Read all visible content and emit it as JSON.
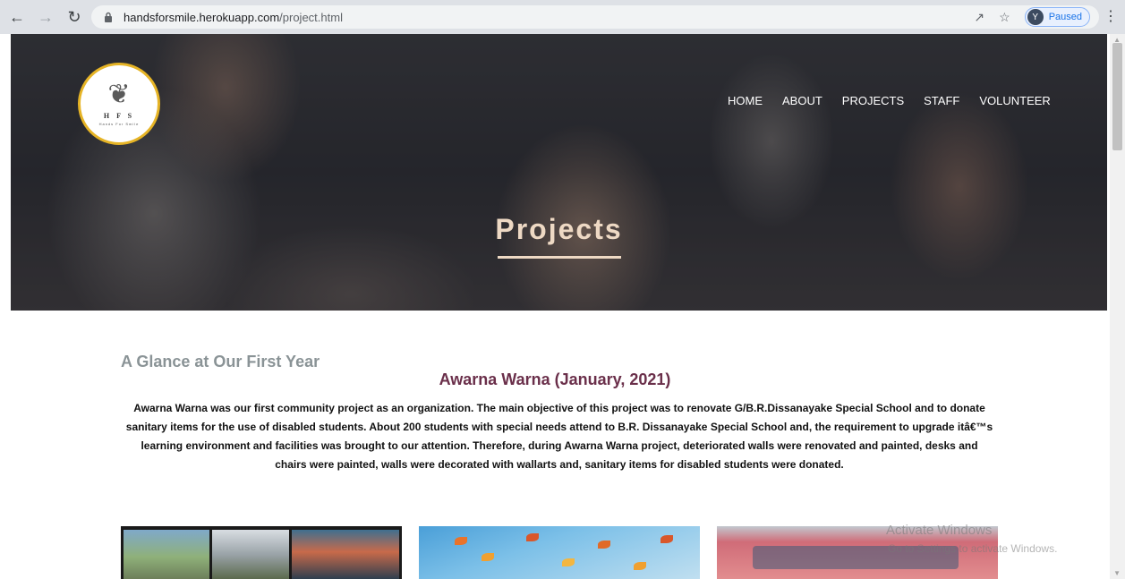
{
  "browser": {
    "url_host": "handsforsmile.herokuapp.com",
    "url_path": "/project.html",
    "profile_initial": "Y",
    "profile_label": "Paused"
  },
  "site": {
    "logo_initials": "H F S",
    "logo_tagline": "Hands For Smile",
    "nav": [
      "HOME",
      "ABOUT",
      "PROJECTS",
      "STAFF",
      "VOLUNTEER"
    ],
    "hero_title": "Projects"
  },
  "content": {
    "section_heading": "A Glance at Our First Year",
    "project_title": "Awarna Warna (January, 2021)",
    "project_description": "Awarna Warna was our first community project as an organization. The main objective of this project was to renovate G/B.R.Dissanayake Special School and to donate sanitary items for the use of disabled students. About 200 students with special needs attend to B.R. Dissanayake Special School and, the requirement to upgrade itâ€™s learning environment and facilities was brought to our attention. Therefore, during Awarna Warna project, deteriorated walls were renovated and painted, desks and chairs were painted, walls were decorated with wallarts and, sanitary items for disabled students were donated."
  },
  "os": {
    "watermark_title": "Activate Windows",
    "watermark_sub": "Go to Settings to activate Windows."
  },
  "colors": {
    "hero_title": "#eed9c4",
    "project_title": "#6a2f4a",
    "section_heading": "#8a9396",
    "logo_ring": "#e6b426"
  }
}
